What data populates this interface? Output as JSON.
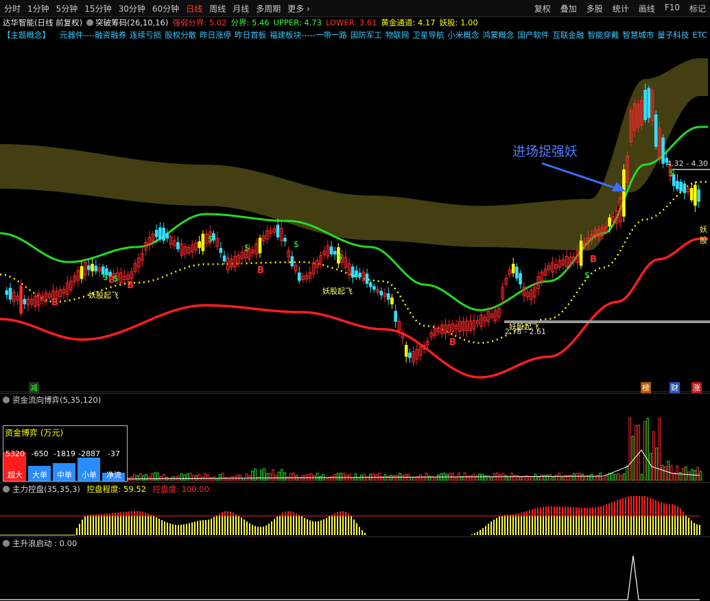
{
  "toolbar": {
    "periods": [
      "分时",
      "1分钟",
      "5分钟",
      "15分钟",
      "30分钟",
      "60分钟",
      "日线",
      "周线",
      "月线",
      "多周期",
      "更多"
    ],
    "active_period": "日线",
    "tools": [
      "复权",
      "叠加",
      "多股",
      "统计",
      "画线",
      "F10",
      "标记"
    ]
  },
  "stock_title": "达华智能(日线 前复权)",
  "indicator": {
    "name": "突破筹码(26,10,16)",
    "strong_weak": "强弱分界: 5.02",
    "divide": "分界: 5.46",
    "upper": "UPPER: 4.73",
    "lower": "LOWER: 3.61",
    "golden": "黄金通道: 4.17",
    "demon": "妖股: 1.00"
  },
  "concept": {
    "label": "【主题概念】",
    "items": [
      "元器件----融资融券",
      "连续亏损",
      "股权分散",
      "昨日涨停",
      "昨日首板",
      "福建板块-----一带一路",
      "国防军工",
      "物联网",
      "卫星导航",
      "小米概念",
      "鸿蒙概念",
      "国产软件",
      "互联金融",
      "智能穿戴",
      "智慧城市",
      "量子科技",
      "ETC"
    ]
  },
  "annotations": {
    "entry_text": "进场捉强妖",
    "demon_fly_1": "妖股起飞",
    "demon_fly_2": "妖股起飞",
    "demon_fly_3": "妖股起飞",
    "right_demon": "妖股",
    "price_range": "4.32 - 4.30",
    "low_range": "2.78 - 2.61",
    "reduce": "减",
    "badge_1": "榜",
    "badge_2": "财",
    "badge_3": "涨"
  },
  "panel_fund": {
    "title": "资金流向博弈(5,35,120)",
    "box_title": "资金博弈 (万元)",
    "items": [
      {
        "label": "超大",
        "value": "5320"
      },
      {
        "label": "大单",
        "value": "-650"
      },
      {
        "label": "中单",
        "value": "-1819"
      },
      {
        "label": "小单",
        "value": "-2887"
      },
      {
        "label": "净流",
        "value": "-37"
      }
    ]
  },
  "panel_control": {
    "title": "主力控盘(35,35,3)",
    "degree": "控盘程度: 59.52",
    "level": "控盘度: 100.00"
  },
  "panel_wave": {
    "title": "主升浪启动 : 0.00"
  },
  "colors": {
    "up": "#ff2a2a",
    "down": "#33e0ff",
    "green_line": "#22dd22",
    "red_line": "#ff1e1e",
    "yellow": "#ffff00",
    "band": "#5a5418"
  }
}
